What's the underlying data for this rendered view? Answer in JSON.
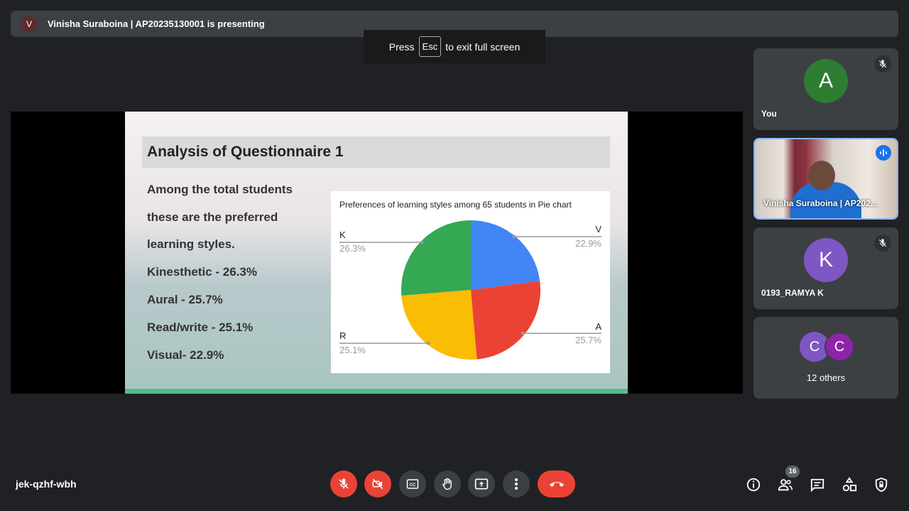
{
  "presenter_bar": {
    "avatar_letter": "V",
    "text": "Vinisha Suraboina | AP20235130001 is presenting"
  },
  "fullscreen_hint": {
    "press": "Press",
    "key": "Esc",
    "rest": "to exit full screen"
  },
  "slide": {
    "title": "Analysis of Questionnaire 1",
    "lines": [
      "Among the total students",
      "these are the preferred",
      "learning styles.",
      "Kinesthetic - 26.3%",
      "Aural - 25.7%",
      "Read/write - 25.1%",
      "Visual- 22.9%"
    ]
  },
  "chart_data": {
    "type": "pie",
    "title": "Preferences of learning styles among 65 students in Pie chart",
    "slices": [
      {
        "label": "V",
        "pct_text": "22.9%",
        "value": 22.9,
        "color": "#4285f4"
      },
      {
        "label": "A",
        "pct_text": "25.7%",
        "value": 25.7,
        "color": "#ea4335"
      },
      {
        "label": "R",
        "pct_text": "25.1%",
        "value": 25.1,
        "color": "#fbbc04"
      },
      {
        "label": "K",
        "pct_text": "26.3%",
        "value": 26.3,
        "color": "#34a853"
      }
    ]
  },
  "participants": [
    {
      "letter": "A",
      "name": "You",
      "color": "#2e7d32"
    },
    {
      "name": "Vinisha Suraboina | AP202..."
    },
    {
      "letter": "K",
      "name": "0193_RAMYA K",
      "color": "#7e57c2"
    }
  ],
  "others": {
    "letters": [
      "C",
      "C"
    ],
    "label": "12 others",
    "colors": [
      "#7e57c2",
      "#8e24aa"
    ]
  },
  "meeting_code": "jek-qzhf-wbh",
  "people_count": "16",
  "icons": {
    "mic_off": "mic-off-icon",
    "cam_off": "camera-off-icon",
    "cc": "captions-icon",
    "hand": "raise-hand-icon",
    "present": "present-icon",
    "more": "more-options-icon",
    "end": "end-call-icon",
    "info": "info-icon",
    "people": "people-icon",
    "chat": "chat-icon",
    "activities": "activities-icon",
    "lock": "host-controls-icon"
  },
  "colors": {
    "danger": "#ea4335",
    "surface": "#3c4043",
    "accent": "#8ab4f8"
  }
}
